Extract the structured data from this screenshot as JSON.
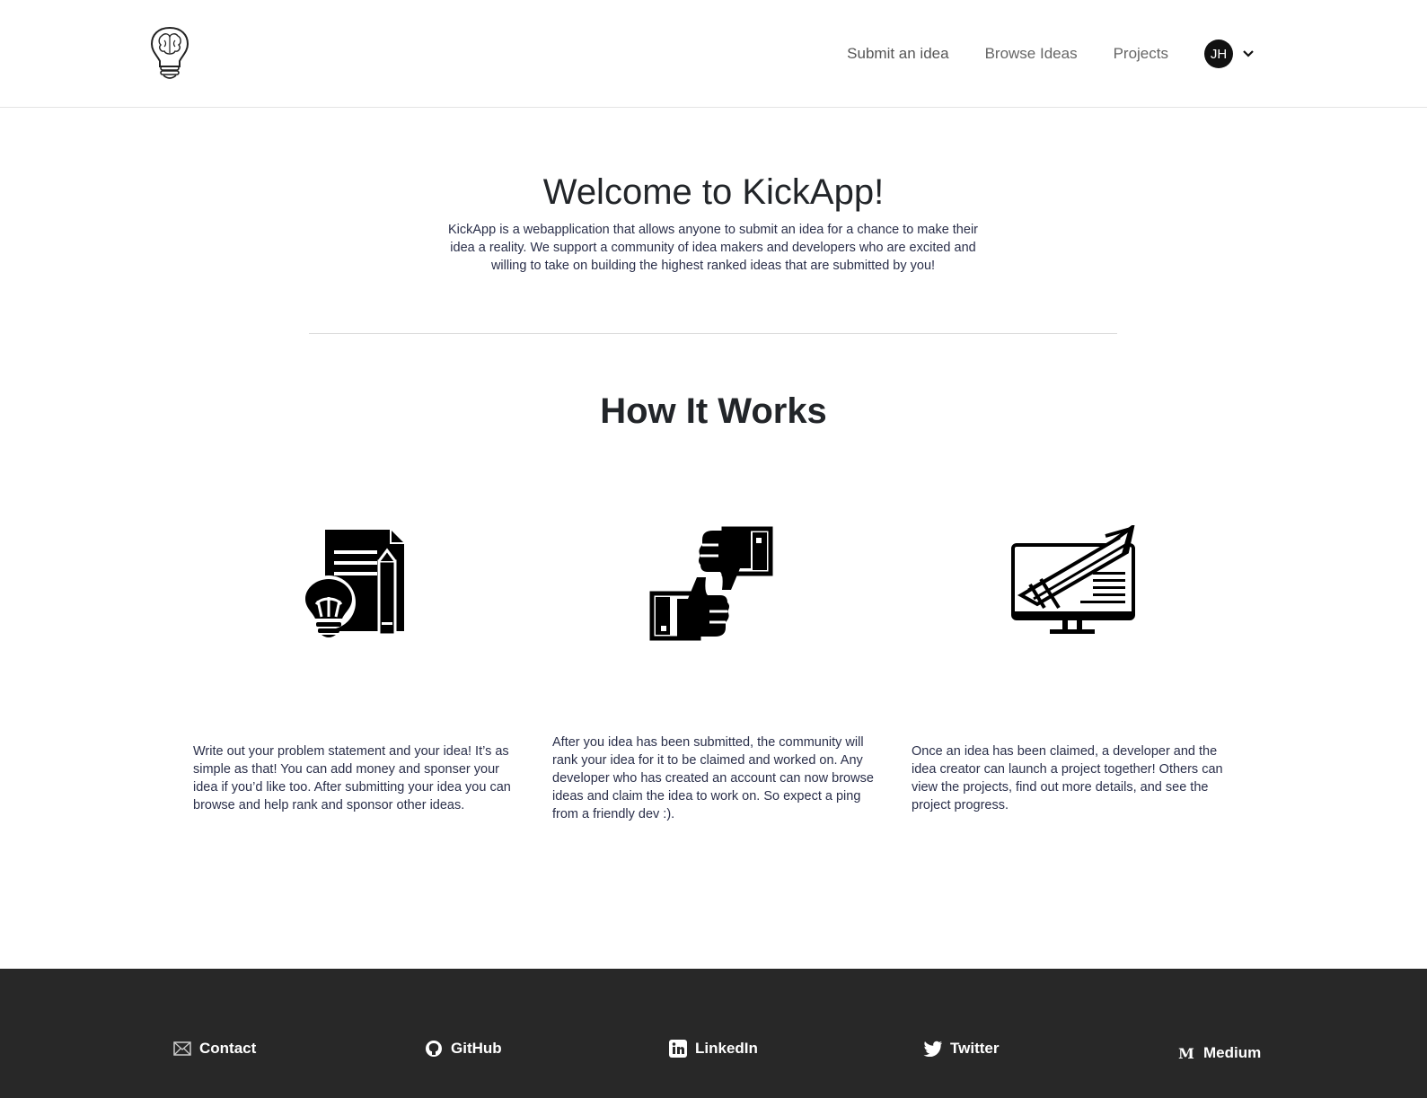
{
  "header": {
    "nav": {
      "submit": "Submit an idea",
      "browse": "Browse Ideas",
      "projects": "Projects"
    },
    "user_initials": "JH"
  },
  "hero": {
    "title": "Welcome to KickApp!",
    "description": "KickApp is a webapplication that allows anyone to submit an idea for a chance to make their idea a reality. We support a community of idea makers and developers who are excited and willing to take on building the highest ranked ideas that are submitted by you!"
  },
  "how": {
    "title": "How It Works",
    "steps": [
      {
        "icon": "document-lightbulb-icon",
        "text": "Write out your problem statement and your idea! It’s as simple as that! You can add money and sponser your idea if you’d like too. After submitting your idea you can browse and help rank and sponsor other ideas."
      },
      {
        "icon": "thumbs-up-down-icon",
        "text": "After you idea has been submitted, the community will rank your idea for it to be claimed and worked on. Any developer who has created an account can now browse ideas and claim the idea to work on. So expect a ping from a friendly dev :)."
      },
      {
        "icon": "monitor-rocket-icon",
        "text": "Once an idea has been claimed, a developer and the idea creator can launch a project together! Others can view the projects, find out more details, and see the project progress."
      }
    ]
  },
  "footer": {
    "contact": "Contact",
    "github": "GitHub",
    "linkedin": "LinkedIn",
    "twitter": "Twitter",
    "medium": "Medium",
    "medium_glyph": "M"
  },
  "colors": {
    "footer_bg": "#282828",
    "text_dark": "#222529",
    "body_text": "#2a2f4a"
  }
}
